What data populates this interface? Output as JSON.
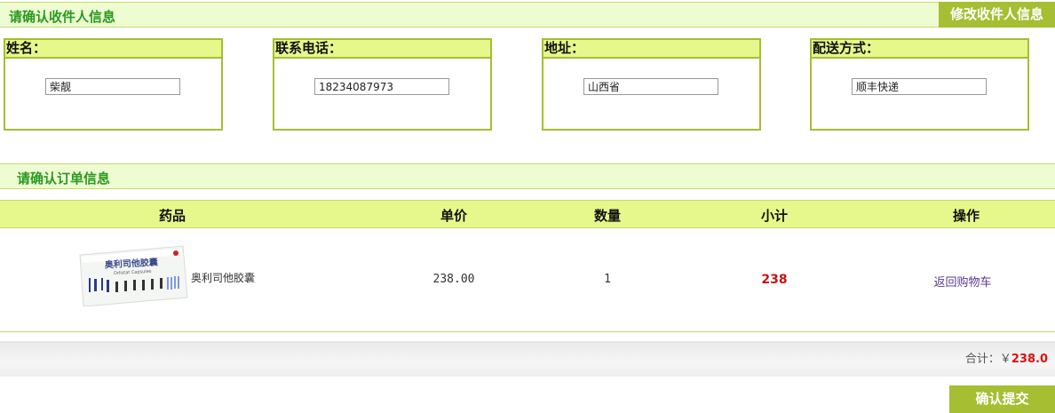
{
  "recipient": {
    "title": "请确认收件人信息",
    "edit_button": "修改收件人信息",
    "fields": [
      {
        "label": "姓名：",
        "value": "柴靓"
      },
      {
        "label": "联系电话：",
        "value": "18234087973"
      },
      {
        "label": "地址：",
        "value": "山西省"
      },
      {
        "label": "配送方式：",
        "value": "顺丰快递"
      }
    ]
  },
  "order": {
    "title": "请确认订单信息",
    "columns": [
      "药品",
      "单价",
      "数量",
      "小计",
      "操作"
    ],
    "items": [
      {
        "name": "奥利司他胶囊",
        "box_text": "奥利司他胶囊",
        "box_subtext": "Orlistat Capsules",
        "price": "238.00",
        "quantity": "1",
        "subtotal": "238",
        "action": "返回购物车"
      }
    ],
    "total_label": "合计：￥",
    "total_value": "238.0",
    "submit_button": "确认提交"
  },
  "colors": {
    "accent": "#a5be32",
    "header_bg": "#e6f88c",
    "title_green": "#2a9a1f",
    "price_red": "#cc1111"
  }
}
